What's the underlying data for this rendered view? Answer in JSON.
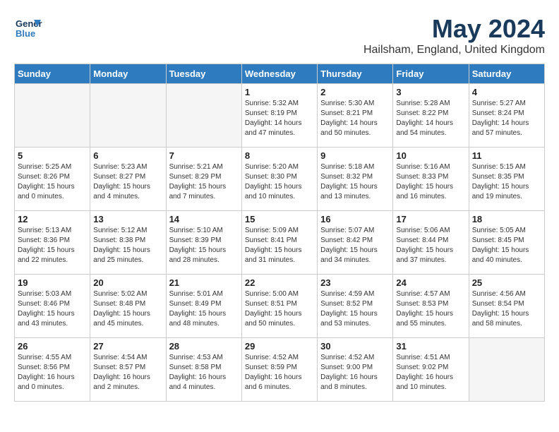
{
  "header": {
    "logo_line1": "General",
    "logo_line2": "Blue",
    "month_title": "May 2024",
    "location": "Hailsham, England, United Kingdom"
  },
  "days_of_week": [
    "Sunday",
    "Monday",
    "Tuesday",
    "Wednesday",
    "Thursday",
    "Friday",
    "Saturday"
  ],
  "weeks": [
    [
      {
        "day": "",
        "content": ""
      },
      {
        "day": "",
        "content": ""
      },
      {
        "day": "",
        "content": ""
      },
      {
        "day": "1",
        "content": "Sunrise: 5:32 AM\nSunset: 8:19 PM\nDaylight: 14 hours\nand 47 minutes."
      },
      {
        "day": "2",
        "content": "Sunrise: 5:30 AM\nSunset: 8:21 PM\nDaylight: 14 hours\nand 50 minutes."
      },
      {
        "day": "3",
        "content": "Sunrise: 5:28 AM\nSunset: 8:22 PM\nDaylight: 14 hours\nand 54 minutes."
      },
      {
        "day": "4",
        "content": "Sunrise: 5:27 AM\nSunset: 8:24 PM\nDaylight: 14 hours\nand 57 minutes."
      }
    ],
    [
      {
        "day": "5",
        "content": "Sunrise: 5:25 AM\nSunset: 8:26 PM\nDaylight: 15 hours\nand 0 minutes."
      },
      {
        "day": "6",
        "content": "Sunrise: 5:23 AM\nSunset: 8:27 PM\nDaylight: 15 hours\nand 4 minutes."
      },
      {
        "day": "7",
        "content": "Sunrise: 5:21 AM\nSunset: 8:29 PM\nDaylight: 15 hours\nand 7 minutes."
      },
      {
        "day": "8",
        "content": "Sunrise: 5:20 AM\nSunset: 8:30 PM\nDaylight: 15 hours\nand 10 minutes."
      },
      {
        "day": "9",
        "content": "Sunrise: 5:18 AM\nSunset: 8:32 PM\nDaylight: 15 hours\nand 13 minutes."
      },
      {
        "day": "10",
        "content": "Sunrise: 5:16 AM\nSunset: 8:33 PM\nDaylight: 15 hours\nand 16 minutes."
      },
      {
        "day": "11",
        "content": "Sunrise: 5:15 AM\nSunset: 8:35 PM\nDaylight: 15 hours\nand 19 minutes."
      }
    ],
    [
      {
        "day": "12",
        "content": "Sunrise: 5:13 AM\nSunset: 8:36 PM\nDaylight: 15 hours\nand 22 minutes."
      },
      {
        "day": "13",
        "content": "Sunrise: 5:12 AM\nSunset: 8:38 PM\nDaylight: 15 hours\nand 25 minutes."
      },
      {
        "day": "14",
        "content": "Sunrise: 5:10 AM\nSunset: 8:39 PM\nDaylight: 15 hours\nand 28 minutes."
      },
      {
        "day": "15",
        "content": "Sunrise: 5:09 AM\nSunset: 8:41 PM\nDaylight: 15 hours\nand 31 minutes."
      },
      {
        "day": "16",
        "content": "Sunrise: 5:07 AM\nSunset: 8:42 PM\nDaylight: 15 hours\nand 34 minutes."
      },
      {
        "day": "17",
        "content": "Sunrise: 5:06 AM\nSunset: 8:44 PM\nDaylight: 15 hours\nand 37 minutes."
      },
      {
        "day": "18",
        "content": "Sunrise: 5:05 AM\nSunset: 8:45 PM\nDaylight: 15 hours\nand 40 minutes."
      }
    ],
    [
      {
        "day": "19",
        "content": "Sunrise: 5:03 AM\nSunset: 8:46 PM\nDaylight: 15 hours\nand 43 minutes."
      },
      {
        "day": "20",
        "content": "Sunrise: 5:02 AM\nSunset: 8:48 PM\nDaylight: 15 hours\nand 45 minutes."
      },
      {
        "day": "21",
        "content": "Sunrise: 5:01 AM\nSunset: 8:49 PM\nDaylight: 15 hours\nand 48 minutes."
      },
      {
        "day": "22",
        "content": "Sunrise: 5:00 AM\nSunset: 8:51 PM\nDaylight: 15 hours\nand 50 minutes."
      },
      {
        "day": "23",
        "content": "Sunrise: 4:59 AM\nSunset: 8:52 PM\nDaylight: 15 hours\nand 53 minutes."
      },
      {
        "day": "24",
        "content": "Sunrise: 4:57 AM\nSunset: 8:53 PM\nDaylight: 15 hours\nand 55 minutes."
      },
      {
        "day": "25",
        "content": "Sunrise: 4:56 AM\nSunset: 8:54 PM\nDaylight: 15 hours\nand 58 minutes."
      }
    ],
    [
      {
        "day": "26",
        "content": "Sunrise: 4:55 AM\nSunset: 8:56 PM\nDaylight: 16 hours\nand 0 minutes."
      },
      {
        "day": "27",
        "content": "Sunrise: 4:54 AM\nSunset: 8:57 PM\nDaylight: 16 hours\nand 2 minutes."
      },
      {
        "day": "28",
        "content": "Sunrise: 4:53 AM\nSunset: 8:58 PM\nDaylight: 16 hours\nand 4 minutes."
      },
      {
        "day": "29",
        "content": "Sunrise: 4:52 AM\nSunset: 8:59 PM\nDaylight: 16 hours\nand 6 minutes."
      },
      {
        "day": "30",
        "content": "Sunrise: 4:52 AM\nSunset: 9:00 PM\nDaylight: 16 hours\nand 8 minutes."
      },
      {
        "day": "31",
        "content": "Sunrise: 4:51 AM\nSunset: 9:02 PM\nDaylight: 16 hours\nand 10 minutes."
      },
      {
        "day": "",
        "content": ""
      }
    ]
  ]
}
